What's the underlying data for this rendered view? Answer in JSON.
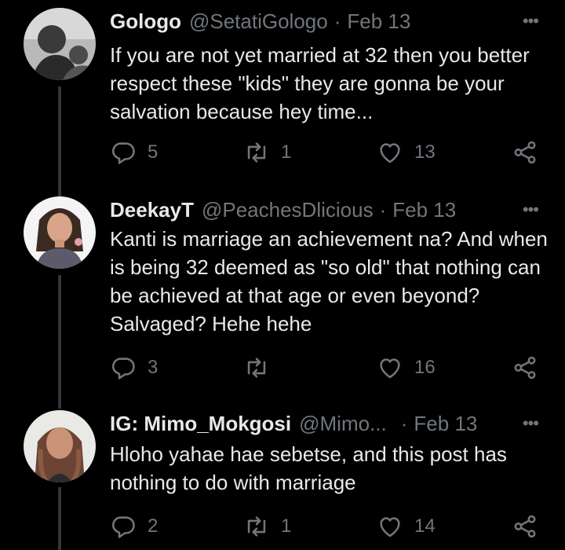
{
  "tweets": [
    {
      "name": "Gologo",
      "handle": "@SetatiGologo",
      "sep": "·",
      "date": "Feb 13",
      "text": "If you are not yet married at 32 then you better respect these \"kids\" they are gonna be your salvation because hey time...",
      "replies": "5",
      "retweets": "1",
      "likes": "13"
    },
    {
      "name": "DeekayT",
      "handle": "@PeachesDlicious",
      "sep": "·",
      "date": "Feb 13",
      "text": "Kanti is marriage an achievement na? And when is being 32 deemed as \"so old\" that nothing can be achieved at that age or even beyond? Salvaged? Hehe hehe",
      "replies": "3",
      "retweets": "",
      "likes": "16"
    },
    {
      "name": "IG: Mimo_Mokgosi",
      "handle": "@Mimo...",
      "sep": "·",
      "date": "Feb 13",
      "text": "Hloho yahae hae sebetse, and this post has nothing to do with marriage",
      "replies": "2",
      "retweets": "1",
      "likes": "14"
    }
  ],
  "more_label": "•••",
  "icons": {
    "reply": "reply-icon",
    "retweet": "retweet-icon",
    "like": "heart-icon",
    "share": "share-icon",
    "more": "more-options-icon"
  },
  "colors": {
    "background": "#000000",
    "text": "#e7e9ea",
    "muted": "#71767b",
    "thread_line": "#333639"
  }
}
